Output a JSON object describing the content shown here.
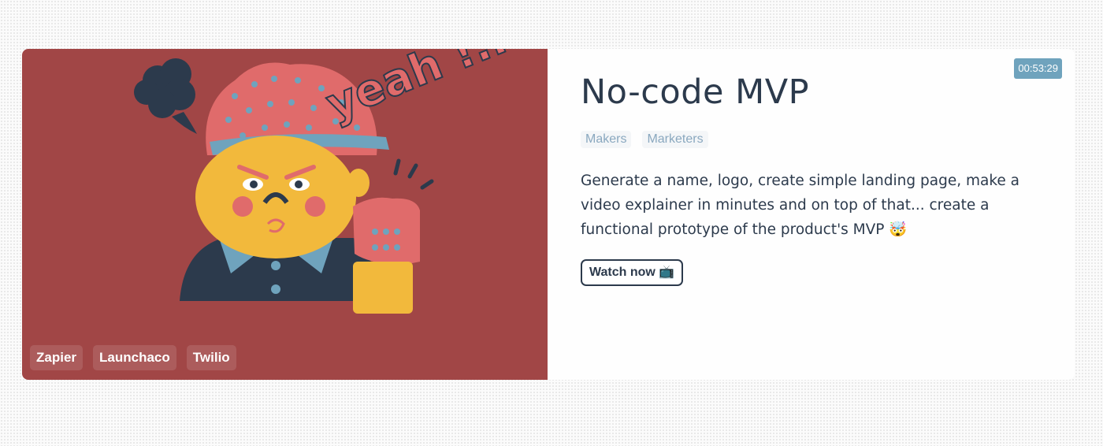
{
  "card": {
    "duration": "00:53:29",
    "title": "No-code MVP",
    "audience": [
      "Makers",
      "Marketers"
    ],
    "description": "Generate a name, logo, create simple landing page, make a video explainer in minutes and on top of that... create a functional prototype of the product's MVP 🤯",
    "cta_label": "Watch now 📺",
    "tools": [
      "Zapier",
      "Launchaco",
      "Twilio"
    ],
    "illustration_text": "yeah !.."
  },
  "colors": {
    "media_bg": "#a14646",
    "duration_bg": "#6fa3bd",
    "text": "#2c3a4c",
    "chip_text": "#8aa8bf"
  }
}
